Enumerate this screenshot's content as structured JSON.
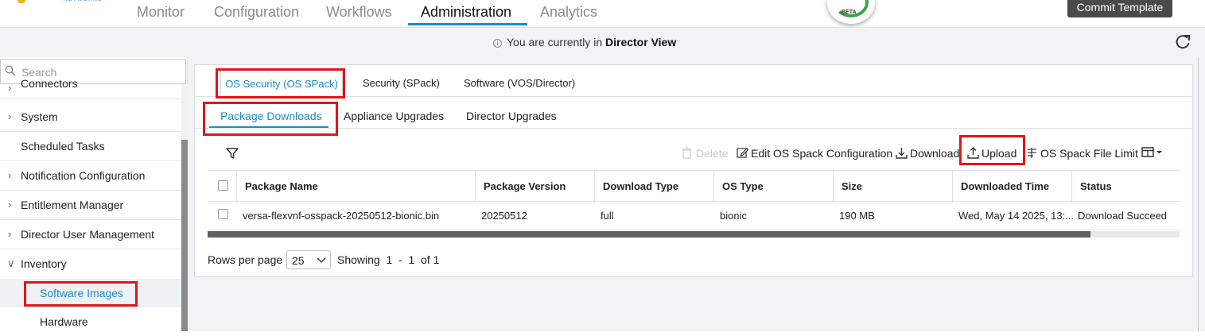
{
  "topnav": {
    "tabs": [
      {
        "label": "Monitor"
      },
      {
        "label": "Configuration"
      },
      {
        "label": "Workflows"
      },
      {
        "label": "Administration"
      },
      {
        "label": "Analytics"
      }
    ],
    "active_tab": "Administration",
    "beta_label": "BETA",
    "commit_button": "Commit Template"
  },
  "banner": {
    "prefix": "You are currently in",
    "view": "Director View"
  },
  "sidebar": {
    "search_placeholder": "Search",
    "items": [
      {
        "label": "Connectors",
        "icon": "chevron-right-icon"
      },
      {
        "label": "System",
        "icon": "chevron-right-icon"
      },
      {
        "label": "Scheduled Tasks"
      },
      {
        "label": "Notification Configuration",
        "icon": "chevron-right-icon"
      },
      {
        "label": "Entitlement Manager",
        "icon": "chevron-right-icon"
      },
      {
        "label": "Director User Management",
        "icon": "chevron-right-icon"
      },
      {
        "label": "Inventory",
        "icon": "chevron-down-icon"
      }
    ],
    "sub_items": [
      {
        "label": "Software Images",
        "active": true
      },
      {
        "label": "Hardware"
      }
    ]
  },
  "tabs_level1": [
    {
      "label": "OS Security (OS SPack)",
      "active": true
    },
    {
      "label": "Security (SPack)"
    },
    {
      "label": "Software (VOS/Director)"
    }
  ],
  "tabs_level2": [
    {
      "label": "Package Downloads",
      "active": true
    },
    {
      "label": "Appliance Upgrades"
    },
    {
      "label": "Director Upgrades"
    }
  ],
  "toolbar": {
    "delete": "Delete",
    "edit_config": "Edit OS Spack Configuration",
    "download": "Download",
    "upload": "Upload",
    "file_limit": "OS Spack File Limit"
  },
  "table": {
    "columns": [
      "Package Name",
      "Package Version",
      "Download Type",
      "OS Type",
      "Size",
      "Downloaded Time",
      "Status"
    ],
    "rows": [
      {
        "package_name": "versa-flexvnf-osspack-20250512-bionic.bin",
        "package_version": "20250512",
        "download_type": "full",
        "os_type": "bionic",
        "size": "190 MB",
        "downloaded_time": "Wed, May 14 2025, 13:...",
        "status": "Download Succeed"
      }
    ]
  },
  "pager": {
    "rows_label": "Rows per page",
    "rows_value": "25",
    "showing": "Showing  1  -  1  of 1"
  },
  "colors": {
    "accent": "#1a8ccc",
    "highlight_box": "#e3141b",
    "commit_button_bg": "#4a4a4a"
  }
}
